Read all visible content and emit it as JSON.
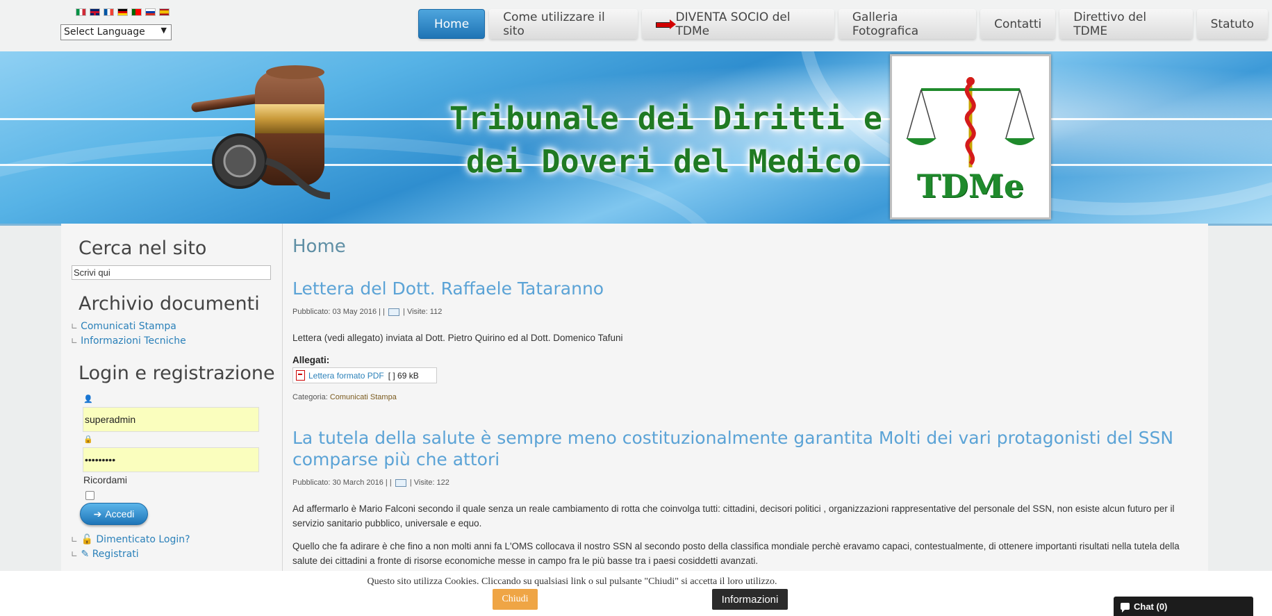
{
  "language": {
    "flags": [
      "it",
      "en",
      "fr",
      "de",
      "pt",
      "ru",
      "es"
    ],
    "select_value": "Select Language"
  },
  "nav": {
    "items": [
      {
        "label": "Home",
        "active": true
      },
      {
        "label": "Come utilizzare il sito"
      },
      {
        "label": "DIVENTA SOCIO del TDMe",
        "icon": "red-arrow-icon"
      },
      {
        "label": "Galleria Fotografica"
      },
      {
        "label": "Contatti"
      },
      {
        "label": "Direttivo del TDME"
      },
      {
        "label": "Statuto"
      }
    ]
  },
  "banner": {
    "title_line1": "Tribunale dei Diritti e",
    "title_line2": "dei Doveri del Medico",
    "logo_text": "TDMe",
    "colors": {
      "title": "#1f7a23",
      "sky": "#57b3e6"
    }
  },
  "sidebar": {
    "search_heading": "Cerca nel sito",
    "search_placeholder": "Scrivi qui",
    "archive_heading": "Archivio documenti",
    "archive_items": [
      "Comunicati Stampa",
      "Informazioni Tecniche"
    ],
    "login_heading": "Login e registrazione",
    "username_value": "superadmin",
    "password_value": "•••••••••",
    "remember_label": "Ricordami",
    "login_button": "Accedi",
    "forgot_link": "Dimenticato Login?",
    "register_link": "Registrati"
  },
  "main": {
    "page_title": "Home",
    "articles": [
      {
        "title": "Lettera del Dott. Raffaele Tataranno",
        "meta_prefix": "Pubblicato: 03 May 2016 | |",
        "meta_suffix": "| Visite: 112",
        "body": "Lettera (vedi allegato) inviata al Dott. Pietro Quirino ed al Dott. Domenico Tafuni",
        "attachments_label": "Allegati:",
        "attachment_name": "Lettera formato PDF",
        "attachment_size": "[ ] 69 kB",
        "category_label": "Categoria:",
        "category_value": "Comunicati Stampa"
      },
      {
        "title": "La tutela della salute è sempre meno costituzionalmente garantita Molti dei vari protagonisti del SSN comparse più che attori",
        "meta_prefix": "Pubblicato: 30 March 2016 | |",
        "meta_suffix": "| Visite: 122",
        "para1": "Ad affermarlo è Mario Falconi secondo il quale senza un reale cambiamento di rotta che coinvolga tutti: cittadini, decisori politici , organizzazioni rappresentative del personale del SSN, non esiste alcun futuro per il servizio sanitario pubblico, universale e equo.",
        "para2": "Quello che fa adirare è che fino a non molti anni fa L'OMS collocava il nostro SSN al secondo posto della classifica mondiale perchè eravamo  capaci, contestualmente,  di ottenere importanti risultati nella tutela della salute dei cittadini a fronte di risorse economiche messe in campo fra le più basse tra i paesi cosiddetti avanzati."
      }
    ]
  },
  "cookie": {
    "text": "Questo sito utilizza Cookies. Cliccando su qualsiasi link o sul pulsante \"Chiudi\" si accetta il loro utilizzo.",
    "close_button": "Chiudi",
    "info_button": "Informazioni",
    "colors": {
      "close": "#efa545",
      "info": "#2b2b2b"
    }
  },
  "chat": {
    "label": "Chat (0)"
  }
}
